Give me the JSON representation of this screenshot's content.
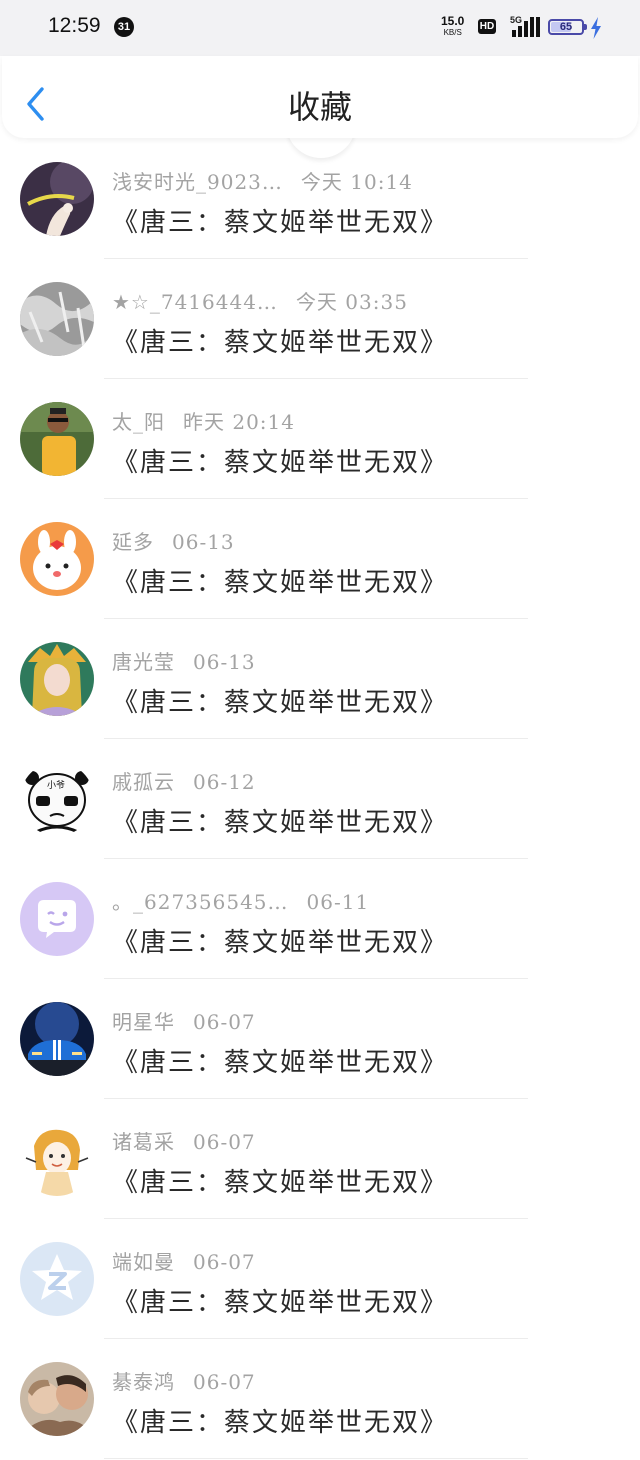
{
  "status_bar": {
    "time": "12:59",
    "notification_count": "31",
    "net_speed": "15.0",
    "net_unit": "KB/S",
    "hd": "HD",
    "network": "5G",
    "battery": "65",
    "battery_level": 0.65
  },
  "header": {
    "back_icon": "chevron-left-icon",
    "title": "收藏"
  },
  "items": [
    {
      "name": "浅安时光_9023…",
      "date": "今天 10:14",
      "message": "《唐三：蔡文姬举世无双》",
      "avatar": "photo-hand"
    },
    {
      "name": "★☆_7416444…",
      "date": "今天 03:35",
      "message": "《唐三：蔡文姬举世无双》",
      "avatar": "photo-frost"
    },
    {
      "name": "太_阳",
      "date": "昨天 20:14",
      "message": "《唐三：蔡文姬举世无双》",
      "avatar": "photo-man"
    },
    {
      "name": "延多",
      "date": "06-13",
      "message": "《唐三：蔡文姬举世无双》",
      "avatar": "cartoon-bunny"
    },
    {
      "name": "唐光莹",
      "date": "06-13",
      "message": "《唐三：蔡文姬举世无双》",
      "avatar": "game-character"
    },
    {
      "name": "戚孤云",
      "date": "06-12",
      "message": "《唐三：蔡文姬举世无双》",
      "avatar": "panda-meme"
    },
    {
      "name": "。_627356545…",
      "date": "06-11",
      "message": "《唐三：蔡文姬举世无双》",
      "avatar": "default-chat"
    },
    {
      "name": "明星华",
      "date": "06-07",
      "message": "《唐三：蔡文姬举世无双》",
      "avatar": "photo-car"
    },
    {
      "name": "诸葛采",
      "date": "06-07",
      "message": "《唐三：蔡文姬举世无双》",
      "avatar": "anime-girl"
    },
    {
      "name": "端如曼",
      "date": "06-07",
      "message": "《唐三：蔡文姬举世无双》",
      "avatar": "default-qzone"
    },
    {
      "name": "綦泰鸿",
      "date": "06-07",
      "message": "《唐三：蔡文姬举世无双》",
      "avatar": "photo-couple"
    }
  ],
  "panda_text": "小爷",
  "colors": {
    "accent": "#2d8ef0",
    "meta_text": "#a3a3a3",
    "message_text": "#2a2a2a",
    "default_avatar_purple": "#d6c8f5",
    "default_avatar_blue": "#dbe7f5"
  }
}
